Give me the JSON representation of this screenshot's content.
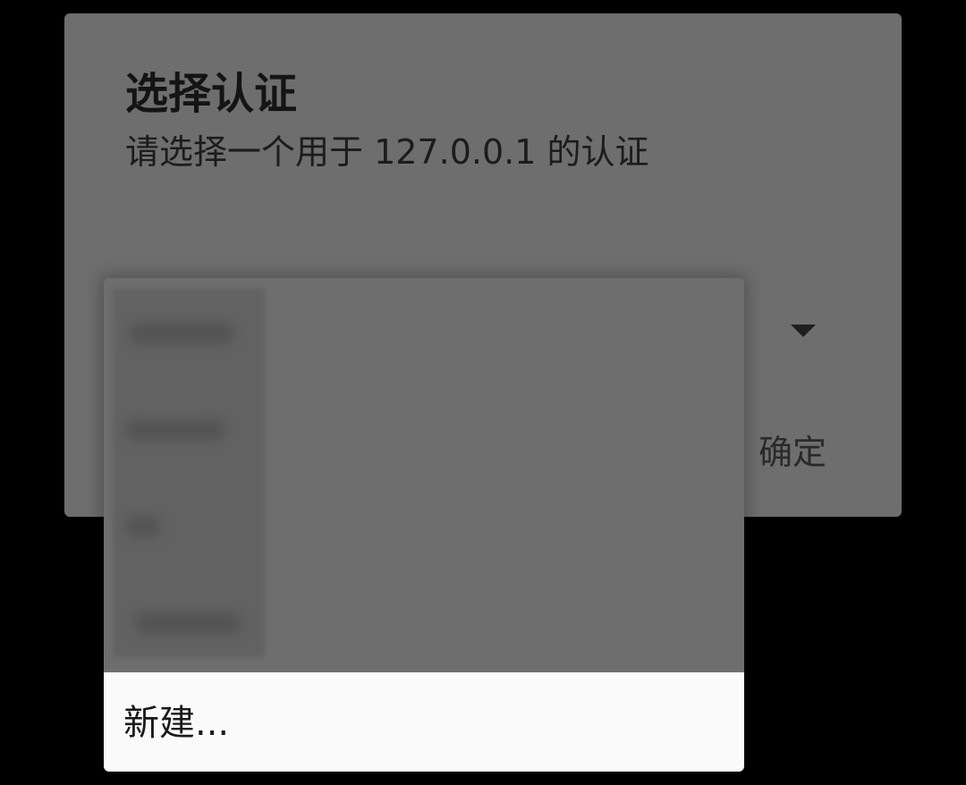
{
  "dialog": {
    "title": "选择认证",
    "message": "请选择一个用于 127.0.0.1 的认证",
    "ok_button": "确定"
  },
  "dropdown": {
    "new_item_label": "新建..."
  },
  "icons": {
    "spinner_arrow": "triangle-down-icon"
  }
}
